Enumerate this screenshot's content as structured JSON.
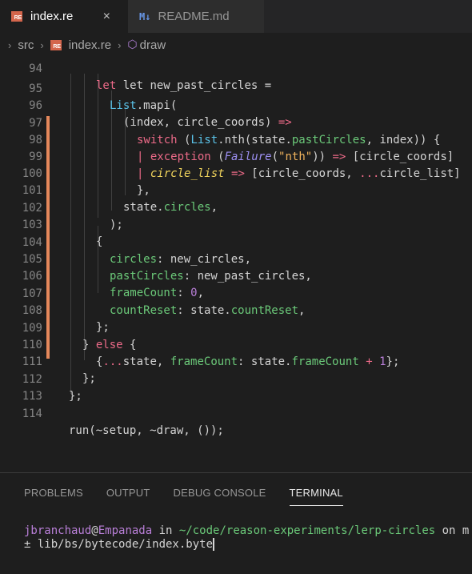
{
  "tabs": [
    {
      "label": "index.re",
      "icon": "reason-file-icon",
      "icon_text": "RE",
      "active": true,
      "close": "×"
    },
    {
      "label": "README.md",
      "icon": "markdown-file-icon",
      "icon_text": "M↓",
      "active": false
    }
  ],
  "breadcrumb": {
    "folder": "src",
    "file": "index.re",
    "file_icon_text": "RE",
    "symbol": "draw",
    "symbol_icon": "method-icon"
  },
  "editor": {
    "partial_top_line": "let new_past_circles =",
    "lines": [
      {
        "n": "95",
        "text": "List.mapi("
      },
      {
        "n": "96",
        "text": "(index, circle_coords) =>"
      },
      {
        "n": "97",
        "text": "switch (List.nth(state.pastCircles, index)) {"
      },
      {
        "n": "98",
        "text": "| exception (Failure(\"nth\")) => [circle_coords]"
      },
      {
        "n": "99",
        "text": "| circle_list => [circle_coords, ...circle_list]"
      },
      {
        "n": "100",
        "text": "},"
      },
      {
        "n": "101",
        "text": "state.circles,"
      },
      {
        "n": "102",
        "text": ");"
      },
      {
        "n": "103",
        "text": "{"
      },
      {
        "n": "104",
        "text": "circles: new_circles,"
      },
      {
        "n": "105",
        "text": "pastCircles: new_past_circles,"
      },
      {
        "n": "106",
        "text": "frameCount: 0,"
      },
      {
        "n": "107",
        "text": "countReset: state.countReset,"
      },
      {
        "n": "108",
        "text": "};"
      },
      {
        "n": "109",
        "text": "} else {"
      },
      {
        "n": "110",
        "text": "{...state, frameCount: state.frameCount + 1};"
      },
      {
        "n": "111",
        "text": "};"
      },
      {
        "n": "112",
        "text": "};"
      },
      {
        "n": "113",
        "text": ""
      },
      {
        "n": "114",
        "text": "run(~setup, ~draw, ());"
      }
    ]
  },
  "panel": {
    "tabs": [
      "PROBLEMS",
      "OUTPUT",
      "DEBUG CONSOLE",
      "TERMINAL"
    ],
    "active_tab": "TERMINAL",
    "terminal": {
      "user": "jbranchaud",
      "at": "@",
      "host": "Empanada",
      "in": " in ",
      "path": "~/code/reason-experiments/lerp-circles",
      "on": " on m",
      "command_line": "± lib/bs/bytecode/index.byte"
    }
  },
  "colors": {
    "background": "#1e1e1e",
    "keyword": "#ec6a88",
    "module": "#5ac2e8",
    "property": "#6bc979",
    "number": "#b97fd8",
    "string": "#f0b35c",
    "modified_gutter": "#e5885b"
  }
}
